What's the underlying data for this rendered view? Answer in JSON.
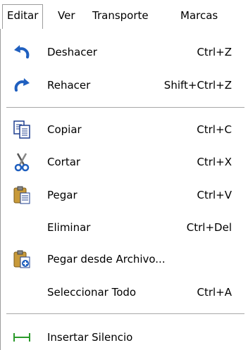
{
  "menubar": {
    "items": [
      {
        "label": "Editar"
      },
      {
        "label": "Ver"
      },
      {
        "label": "Transporte"
      },
      {
        "label": "Marcas"
      }
    ]
  },
  "menu": {
    "items": [
      {
        "label": "Deshacer",
        "shortcut": "Ctrl+Z",
        "icon": "undo-icon"
      },
      {
        "label": "Rehacer",
        "shortcut": "Shift+Ctrl+Z",
        "icon": "redo-icon"
      },
      {
        "label": "Copiar",
        "shortcut": "Ctrl+C",
        "icon": "copy-icon"
      },
      {
        "label": "Cortar",
        "shortcut": "Ctrl+X",
        "icon": "cut-icon"
      },
      {
        "label": "Pegar",
        "shortcut": "Ctrl+V",
        "icon": "paste-icon"
      },
      {
        "label": "Eliminar",
        "shortcut": "Ctrl+Del"
      },
      {
        "label": "Pegar desde Archivo...",
        "icon": "paste-from-file-icon"
      },
      {
        "label": "Seleccionar Todo",
        "shortcut": "Ctrl+A"
      },
      {
        "label": "Insertar Silencio",
        "icon": "insert-silence-icon"
      }
    ]
  },
  "colors": {
    "icon_blue": "#1f5fbf",
    "icon_green": "#2a9a2a",
    "clipboard": "#c89a3a"
  }
}
